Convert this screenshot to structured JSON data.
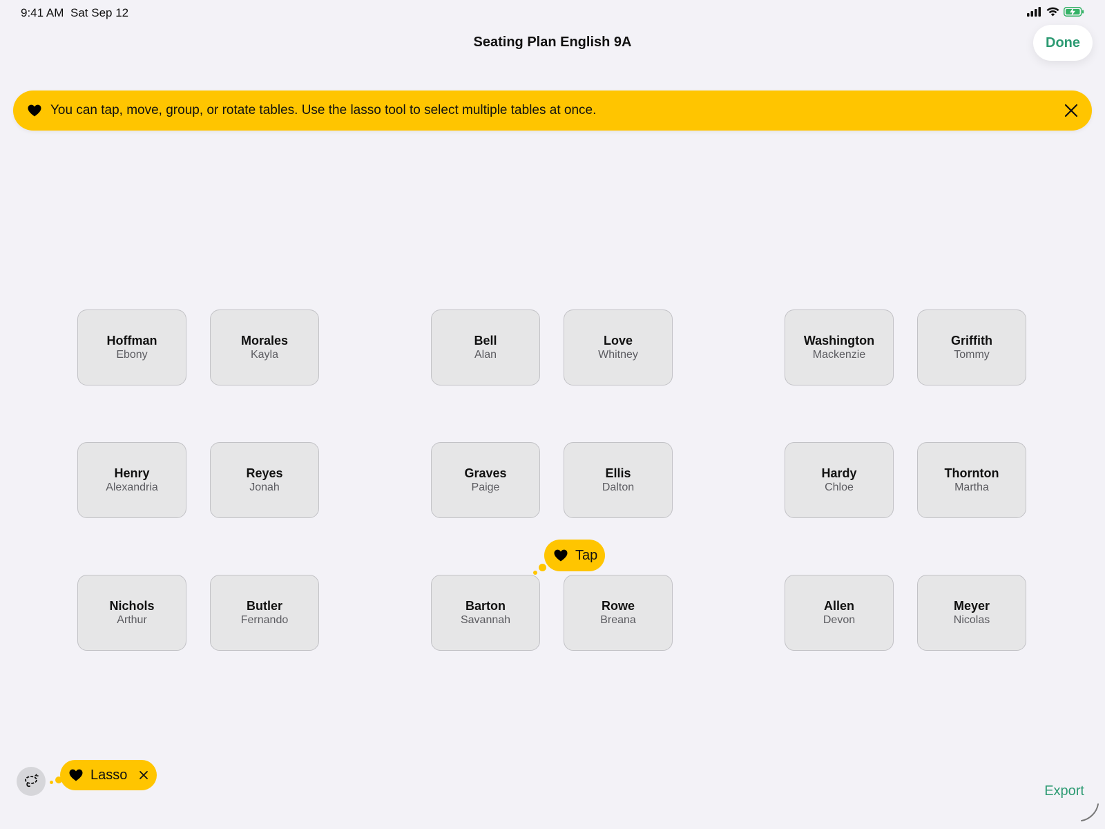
{
  "status_bar": {
    "time": "9:41 AM",
    "date": "Sat Sep 12",
    "icons": [
      "signal-icon",
      "wifi-icon",
      "battery-charging-icon"
    ]
  },
  "nav": {
    "title": "Seating Plan English 9A",
    "done_label": "Done"
  },
  "banner": {
    "text": "You can tap, move, group, or rotate tables. Use the lasso tool to select multiple tables at once.",
    "icon": "heart-icon",
    "close_icon": "close-icon"
  },
  "desks": [
    {
      "last": "Hoffman",
      "first": "Ebony"
    },
    {
      "last": "Morales",
      "first": "Kayla"
    },
    {
      "last": "Bell",
      "first": "Alan"
    },
    {
      "last": "Love",
      "first": "Whitney"
    },
    {
      "last": "Washington",
      "first": "Mackenzie"
    },
    {
      "last": "Griffith",
      "first": "Tommy"
    },
    {
      "last": "Henry",
      "first": "Alexandria"
    },
    {
      "last": "Reyes",
      "first": "Jonah"
    },
    {
      "last": "Graves",
      "first": "Paige"
    },
    {
      "last": "Ellis",
      "first": "Dalton"
    },
    {
      "last": "Hardy",
      "first": "Chloe"
    },
    {
      "last": "Thornton",
      "first": "Martha"
    },
    {
      "last": "Nichols",
      "first": "Arthur"
    },
    {
      "last": "Butler",
      "first": "Fernando"
    },
    {
      "last": "Barton",
      "first": "Savannah"
    },
    {
      "last": "Rowe",
      "first": "Breana"
    },
    {
      "last": "Allen",
      "first": "Devon"
    },
    {
      "last": "Meyer",
      "first": "Nicolas"
    }
  ],
  "tips": {
    "tap_label": "Tap",
    "lasso_label": "Lasso"
  },
  "toolbar": {
    "lasso_icon": "lasso-icon",
    "export_label": "Export"
  },
  "colors": {
    "accent": "#2c9a72",
    "tip_yellow": "#ffc500",
    "background": "#f3f2f7",
    "desk_fill": "#e6e6e7"
  }
}
